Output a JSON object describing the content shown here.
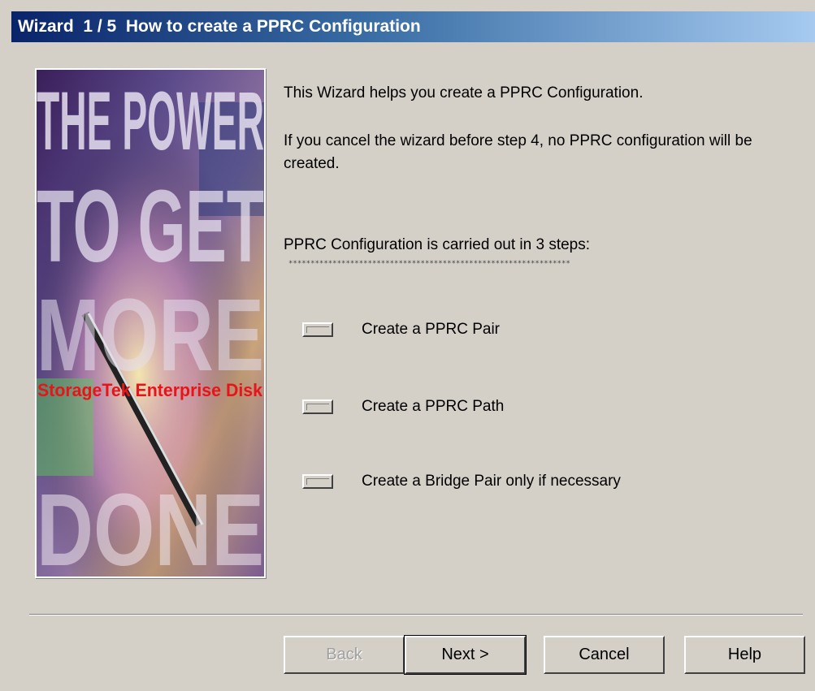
{
  "window": {
    "title": "Wizard  1 / 5  How to create a PPRC Configuration"
  },
  "banner": {
    "lines": [
      "THE POWER",
      "TO GET",
      "MORE",
      "DONE"
    ],
    "tagline": "StorageTek Enterprise Disk"
  },
  "content": {
    "intro": "This Wizard helps you create a PPRC Configuration.",
    "cancel_note": "If you cancel the wizard before step 4, no PPRC configuration will be created.",
    "steps_heading": "PPRC Configuration is carried out in 3 steps:",
    "separator_text": "****************************************************************",
    "steps": [
      {
        "label": "Create a PPRC Pair"
      },
      {
        "label": "Create a PPRC Path"
      },
      {
        "label": "Create a Bridge Pair only if necessary"
      }
    ]
  },
  "buttons": {
    "back": "Back",
    "next": "Next >",
    "cancel": "Cancel",
    "help": "Help"
  },
  "colors": {
    "title_start": "#0a246a",
    "title_end": "#a6caf0",
    "dialog_bg": "#d4d0c8",
    "banner_red": "#e8141a"
  }
}
